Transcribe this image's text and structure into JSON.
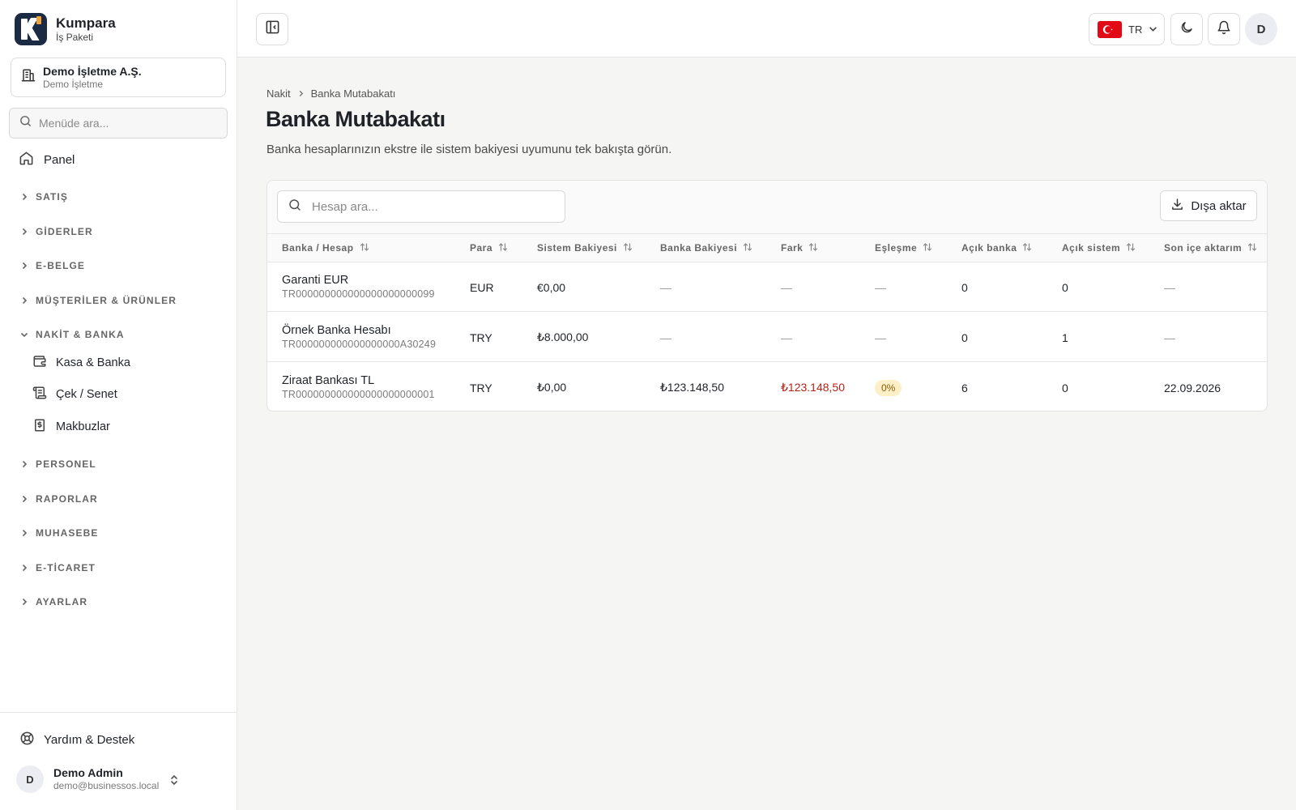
{
  "brand": {
    "name": "Kumpara",
    "subtitle": "İş Paketi"
  },
  "company": {
    "name": "Demo İşletme A.Ş.",
    "sub": "Demo İşletme"
  },
  "menu_search": {
    "placeholder": "Menüde ara..."
  },
  "nav": {
    "panel": "Panel",
    "sections": [
      {
        "label": "SATIŞ"
      },
      {
        "label": "GİDERLER"
      },
      {
        "label": "E-BELGE"
      },
      {
        "label": "MÜŞTERİLER & ÜRÜNLER"
      },
      {
        "label": "NAKİT & BANKA",
        "expanded": true,
        "items": [
          {
            "label": "Kasa & Banka",
            "icon": "wallet-icon"
          },
          {
            "label": "Çek / Senet",
            "icon": "receipt-icon"
          },
          {
            "label": "Makbuzlar",
            "icon": "dollar-receipt-icon"
          }
        ]
      },
      {
        "label": "PERSONEL"
      },
      {
        "label": "RAPORLAR"
      },
      {
        "label": "MUHASEBE"
      },
      {
        "label": "E-TİCARET"
      },
      {
        "label": "AYARLAR"
      }
    ]
  },
  "footer": {
    "help": "Yardım & Destek",
    "user": {
      "initial": "D",
      "name": "Demo Admin",
      "email": "demo@businessos.local"
    }
  },
  "topbar": {
    "language": "TR",
    "avatar_initial": "D"
  },
  "breadcrumb": [
    "Nakit",
    "Banka Mutabakatı"
  ],
  "page": {
    "title": "Banka Mutabakatı",
    "description": "Banka hesaplarınızın ekstre ile sistem bakiyesi uyumunu tek bakışta görün."
  },
  "table": {
    "search_placeholder": "Hesap ara...",
    "export_label": "Dışa aktar",
    "columns": [
      "Banka / Hesap",
      "Para",
      "Sistem Bakiyesi",
      "Banka Bakiyesi",
      "Fark",
      "Eşleşme",
      "Açık banka",
      "Açık sistem",
      "Son içe aktarım"
    ],
    "rows": [
      {
        "name": "Garanti EUR",
        "iban": "TR000000000000000000000099",
        "currency": "EUR",
        "system_balance": "€0,00",
        "bank_balance": "—",
        "difference": "—",
        "match": "—",
        "open_bank": "0",
        "open_system": "0",
        "last_import": "—"
      },
      {
        "name": "Örnek Banka Hesabı",
        "iban": "TR000000000000000000A30249",
        "currency": "TRY",
        "system_balance": "₺8.000,00",
        "bank_balance": "—",
        "difference": "—",
        "match": "—",
        "open_bank": "0",
        "open_system": "1",
        "last_import": "—"
      },
      {
        "name": "Ziraat Bankası TL",
        "iban": "TR000000000000000000000001",
        "currency": "TRY",
        "system_balance": "₺0,00",
        "bank_balance": "₺123.148,50",
        "difference": "₺123.148,50",
        "match": "0%",
        "open_bank": "6",
        "open_system": "0",
        "last_import": "22.09.2026"
      }
    ]
  },
  "colors": {
    "brand_navy": "#1c2b44",
    "negative": "#b42318",
    "badge_bg": "#fdf0c8"
  }
}
